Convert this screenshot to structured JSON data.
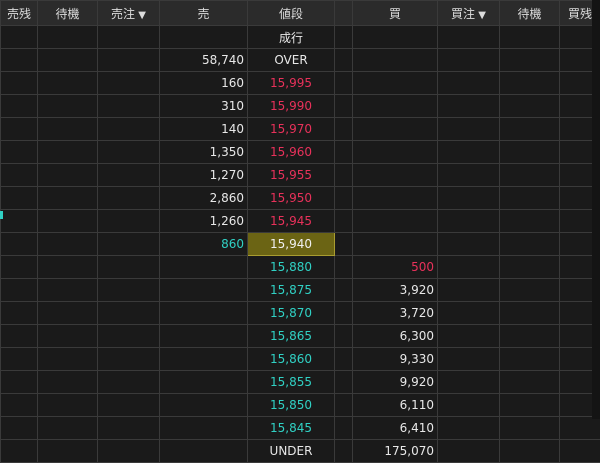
{
  "headers": [
    "売残",
    "待機",
    "売注",
    "売",
    "値段",
    "",
    "買",
    "買注",
    "待機",
    "買残"
  ],
  "rows": [
    {
      "sell": "",
      "price": "成行",
      "buy": ""
    },
    {
      "sell": "58,740",
      "price": "OVER",
      "buy": ""
    },
    {
      "sell": "160",
      "price": "15,995",
      "buy": "",
      "price_color": "red"
    },
    {
      "sell": "310",
      "price": "15,990",
      "buy": "",
      "price_color": "red"
    },
    {
      "sell": "140",
      "price": "15,970",
      "buy": "",
      "price_color": "red"
    },
    {
      "sell": "1,350",
      "price": "15,960",
      "buy": "",
      "price_color": "red"
    },
    {
      "sell": "1,270",
      "price": "15,955",
      "buy": "",
      "price_color": "red"
    },
    {
      "sell": "2,860",
      "price": "15,950",
      "buy": "",
      "price_color": "red"
    },
    {
      "sell": "1,260",
      "price": "15,945",
      "buy": "",
      "price_color": "red"
    },
    {
      "sell": "860",
      "price": "15,940",
      "buy": "",
      "price_color": "highlight",
      "sell_color": "cyan"
    },
    {
      "sell": "",
      "price": "15,880",
      "buy": "500",
      "price_color": "cyan",
      "buy_color": "red"
    },
    {
      "sell": "",
      "price": "15,875",
      "buy": "3,920",
      "price_color": "cyan"
    },
    {
      "sell": "",
      "price": "15,870",
      "buy": "3,720",
      "price_color": "cyan"
    },
    {
      "sell": "",
      "price": "15,865",
      "buy": "6,300",
      "price_color": "cyan"
    },
    {
      "sell": "",
      "price": "15,860",
      "buy": "9,330",
      "price_color": "cyan"
    },
    {
      "sell": "",
      "price": "15,855",
      "buy": "9,920",
      "price_color": "cyan"
    },
    {
      "sell": "",
      "price": "15,850",
      "buy": "6,110",
      "price_color": "cyan"
    },
    {
      "sell": "",
      "price": "15,845",
      "buy": "6,410",
      "price_color": "cyan"
    },
    {
      "sell": "",
      "price": "UNDER",
      "buy": "175,070"
    }
  ],
  "colors": {
    "red": "#e8315a",
    "cyan": "#30d1c4",
    "highlight_bg": "#6b6414"
  },
  "sort_columns": [
    2,
    7
  ]
}
